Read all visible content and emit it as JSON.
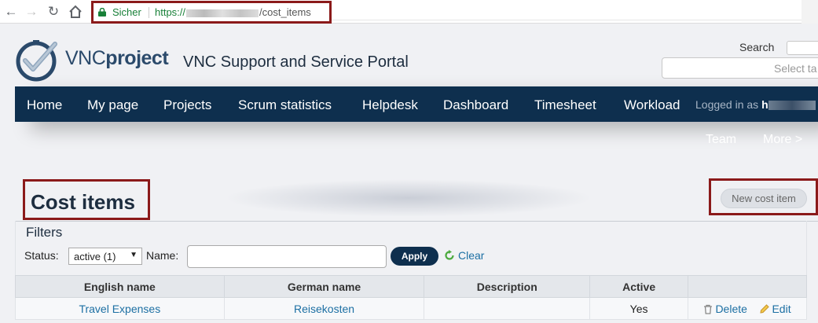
{
  "browser": {
    "secure_label": "Sicher",
    "url_prefix": "https://",
    "url_path": "/cost_items"
  },
  "header": {
    "brand_light": "VNC",
    "brand_bold": "project",
    "portal_title": "VNC Support and Service Portal",
    "search_label": "Search",
    "project_select_placeholder": "Select ta"
  },
  "main_menu": {
    "items": [
      "Home",
      "My page",
      "Projects",
      "Scrum statistics",
      "Helpdesk",
      "Dashboard",
      "Timesheet",
      "Workload"
    ],
    "logged_in_label": "Logged in as",
    "user_initial": "h"
  },
  "sub_menu": {
    "items": [
      "Team",
      "More >"
    ]
  },
  "page": {
    "title": "Cost items",
    "new_button": "New cost item"
  },
  "filters": {
    "title": "Filters",
    "status_label": "Status:",
    "status_value": "active (1)",
    "name_label": "Name:",
    "name_value": "",
    "apply_label": "Apply",
    "clear_label": "Clear"
  },
  "table": {
    "headers": [
      "English name",
      "German name",
      "Description",
      "Active",
      ""
    ],
    "rows": [
      {
        "english": "Travel Expenses",
        "german": "Reisekosten",
        "description": "",
        "active": "Yes",
        "delete": "Delete",
        "edit": "Edit"
      }
    ]
  },
  "colors": {
    "nav_bg": "#0e2f4e",
    "highlight_border": "#8b1a1a",
    "link": "#1c6fa3",
    "secure_green": "#188038"
  }
}
